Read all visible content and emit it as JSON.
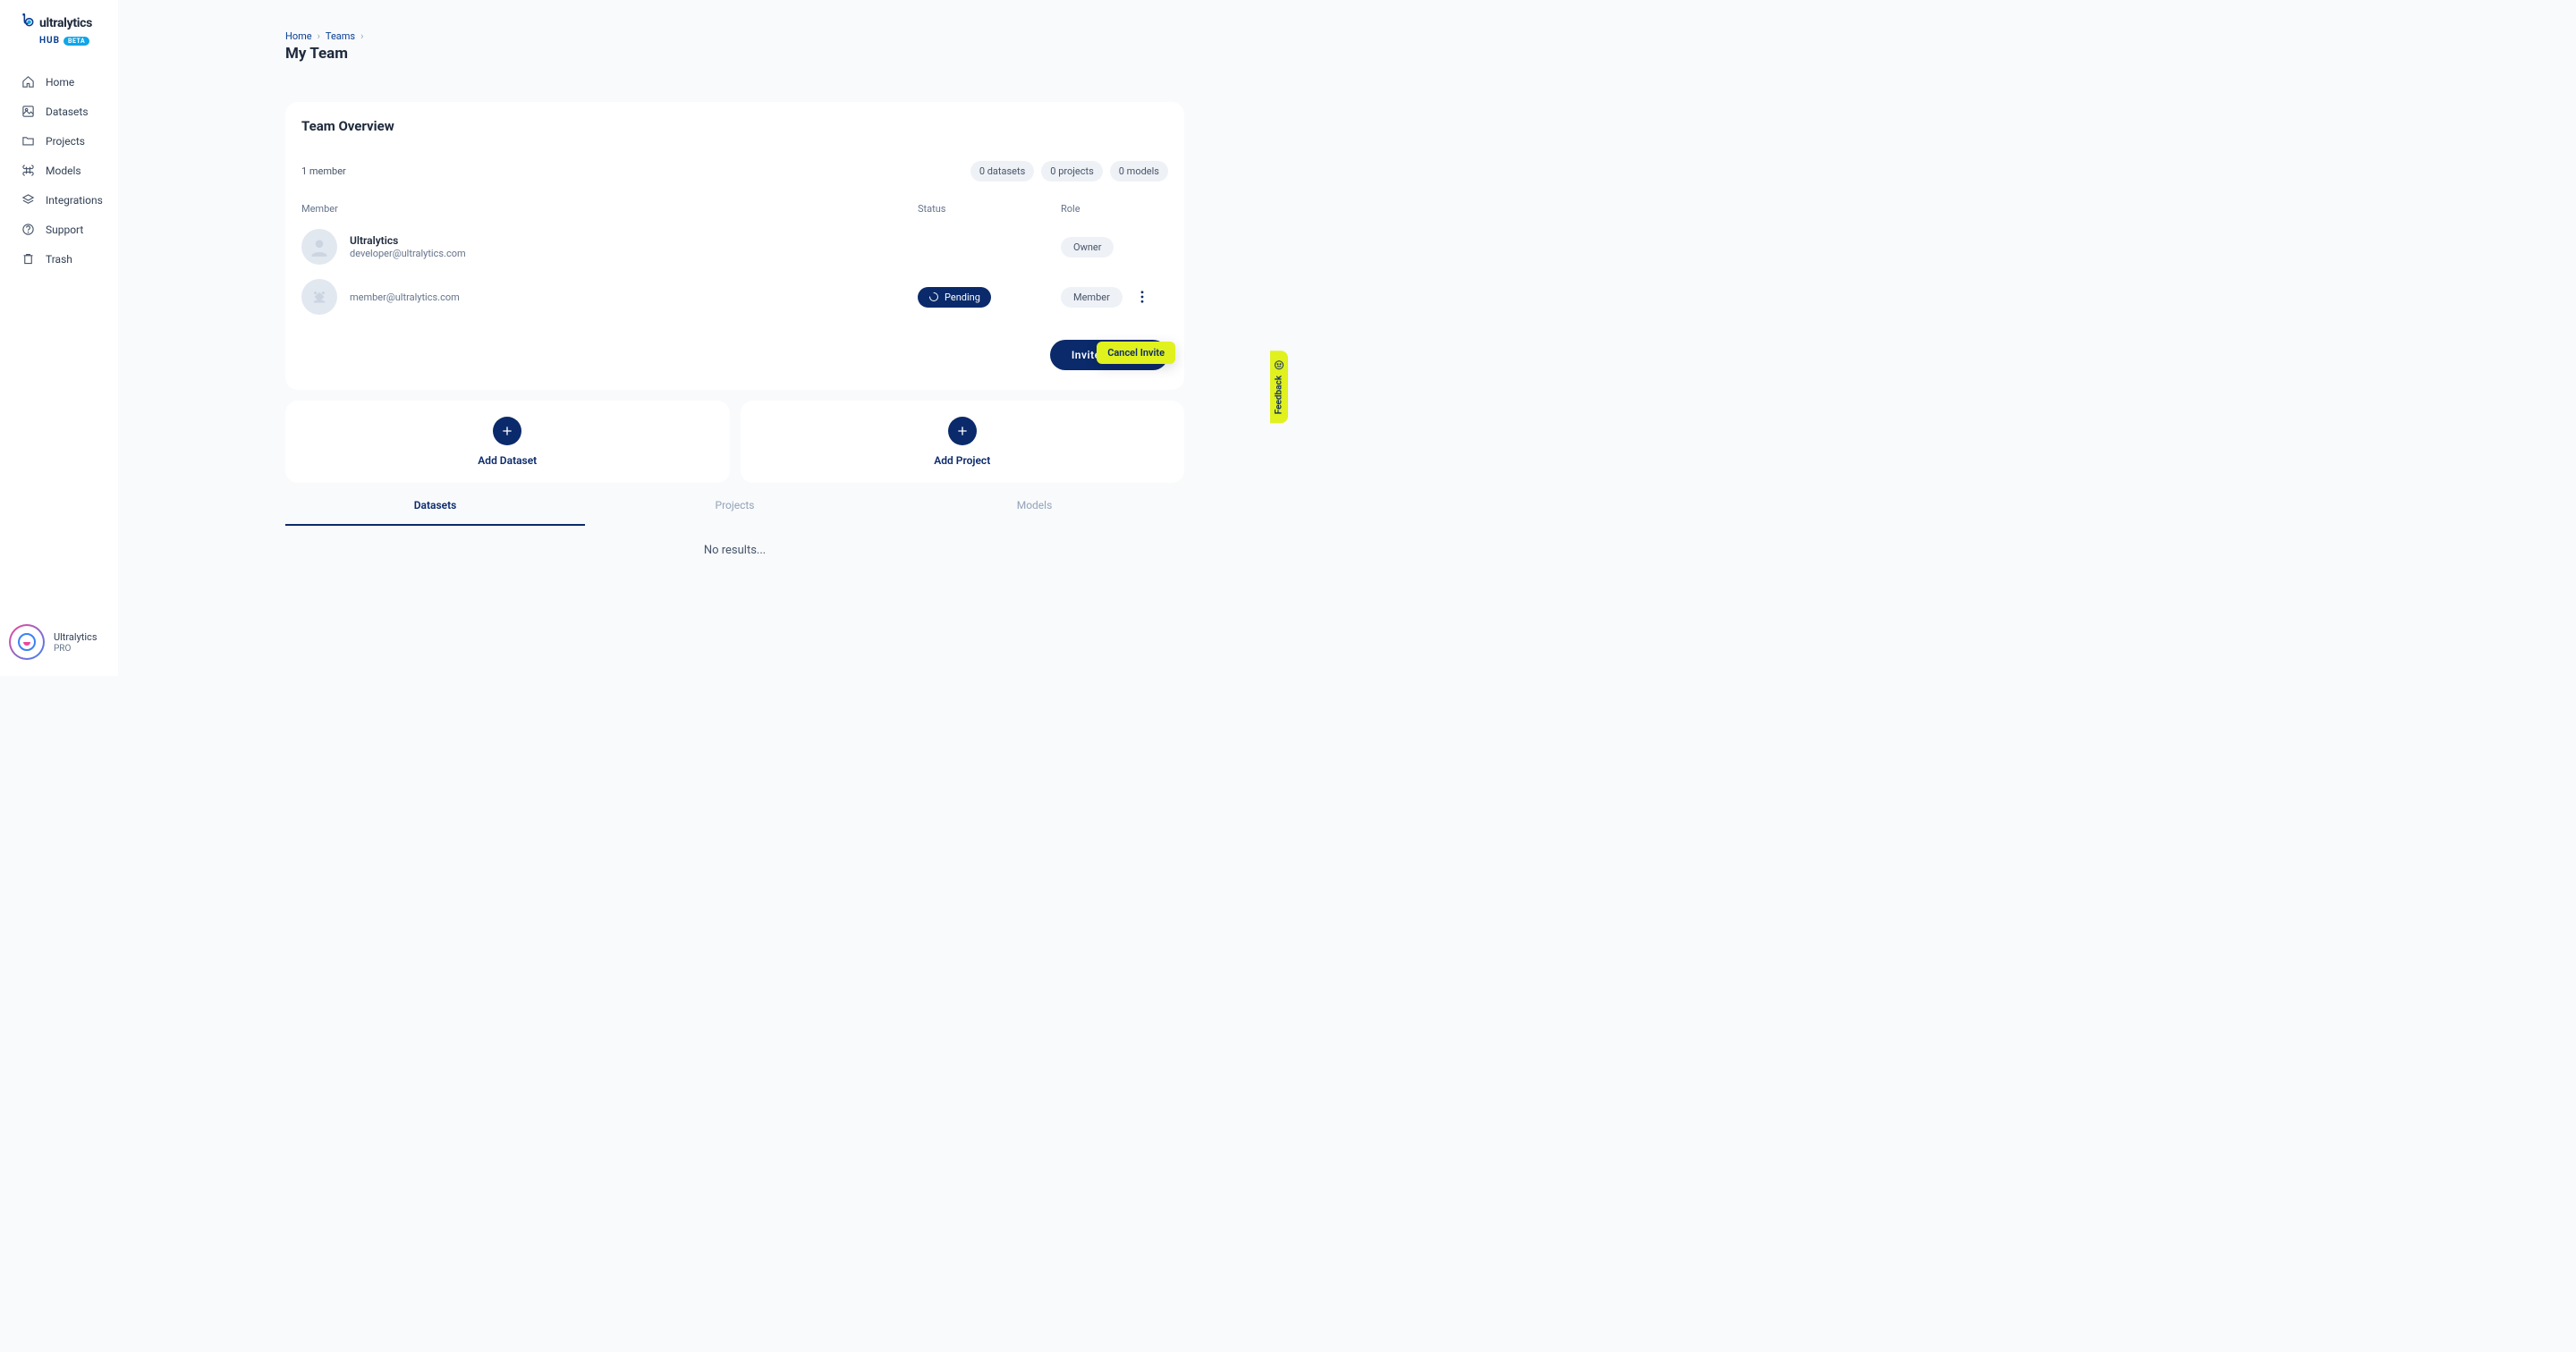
{
  "brand": {
    "name": "ultralytics",
    "hub": "HUB",
    "beta": "BETA"
  },
  "nav": {
    "items": [
      {
        "label": "Home",
        "key": "home"
      },
      {
        "label": "Datasets",
        "key": "datasets"
      },
      {
        "label": "Projects",
        "key": "projects"
      },
      {
        "label": "Models",
        "key": "models"
      },
      {
        "label": "Integrations",
        "key": "integrations"
      },
      {
        "label": "Support",
        "key": "support"
      },
      {
        "label": "Trash",
        "key": "trash"
      }
    ]
  },
  "user": {
    "name": "Ultralytics",
    "plan": "PRO"
  },
  "crumbs": {
    "home": "Home",
    "teams": "Teams"
  },
  "page": {
    "title": "My Team"
  },
  "overview": {
    "title": "Team Overview",
    "count": "1 member",
    "pills": {
      "datasets": "0 datasets",
      "projects": "0 projects",
      "models": "0 models"
    },
    "headers": {
      "member": "Member",
      "status": "Status",
      "role": "Role"
    },
    "rows": [
      {
        "name": "Ultralytics",
        "email": "developer@ultralytics.com",
        "status": "",
        "role": "Owner"
      },
      {
        "name": "",
        "email": "member@ultralytics.com",
        "status": "Pending",
        "role": "Member"
      }
    ],
    "invite_label": "Invite Member",
    "menu": {
      "cancel": "Cancel Invite"
    }
  },
  "add": {
    "dataset": "Add Dataset",
    "project": "Add Project"
  },
  "tabs": {
    "datasets": "Datasets",
    "projects": "Projects",
    "models": "Models"
  },
  "empty": "No results...",
  "feedback": "Feedback"
}
